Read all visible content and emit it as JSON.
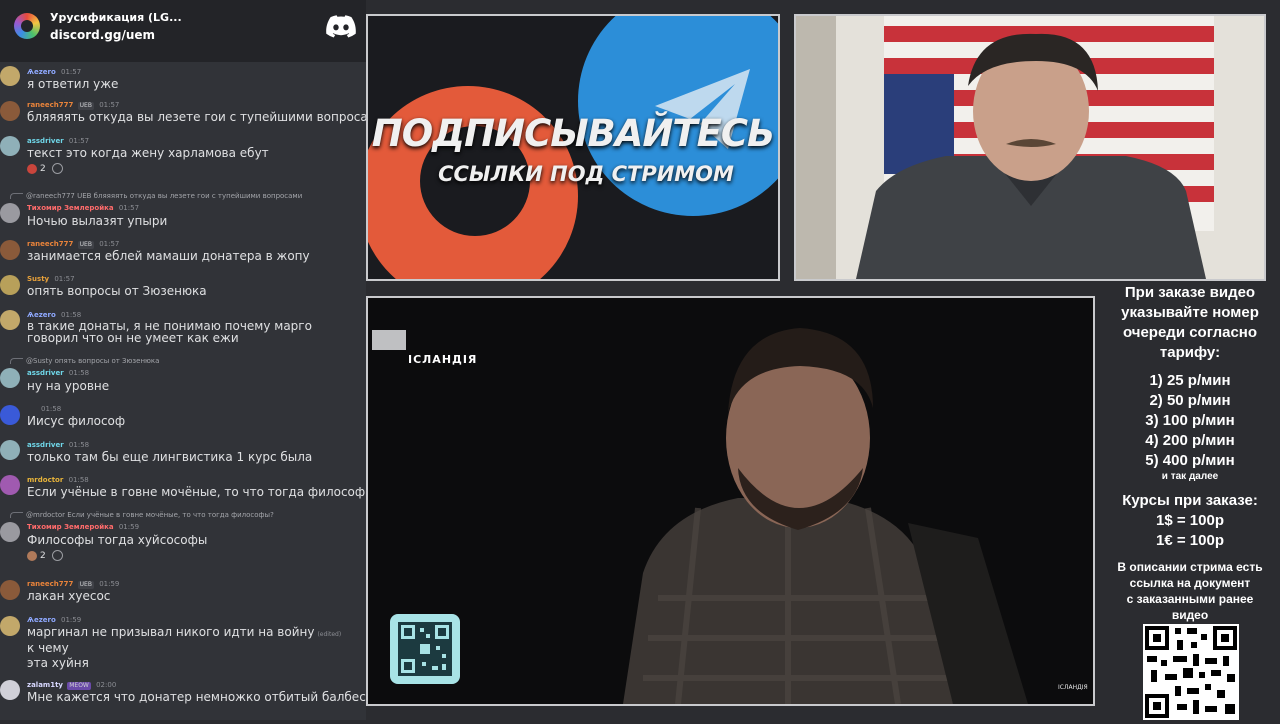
{
  "chat": {
    "server_name": "Урусификация (LG...",
    "invite": "discord.gg/uem",
    "messages": [
      {
        "user": "Ѧezero",
        "user_color": "#8fa9ff",
        "badge": "",
        "time": "01:57",
        "text": "я ответил уже"
      },
      {
        "user": "raneech777",
        "user_color": "#e8833a",
        "badge": "UEB",
        "time": "01:57",
        "text": "бляяяять откуда вы лезете гои с тупейшими вопросами"
      },
      {
        "user": "assdriver",
        "user_color": "#6fd6e8",
        "badge": "",
        "time": "01:57",
        "text": "текст это когда жену харламова ебут",
        "reaction_count": "2"
      },
      {
        "reply": "@raneech777 UEB бляяяять откуда вы лезете гои с тупейшими вопросами",
        "user": "Тихомир Землеройка",
        "user_color": "#ff6b6b",
        "badge": "",
        "time": "01:57",
        "text": "Ночью вылазят упыри"
      },
      {
        "user": "raneech777",
        "user_color": "#e8833a",
        "badge": "UEB",
        "time": "01:57",
        "text": "занимается еблей мамаши донатера в жопу"
      },
      {
        "user": "Susty",
        "user_color": "#e8a13a",
        "badge": "",
        "time": "01:57",
        "text": "опять вопросы от Зюзенюка"
      },
      {
        "user": "Ѧezero",
        "user_color": "#8fa9ff",
        "badge": "",
        "time": "01:58",
        "text": "в такие донаты, я не понимаю почему марго говорил что он не умеет как ежи"
      },
      {
        "reply": "@Susty опять вопросы от Зюзенюка",
        "user": "assdriver",
        "user_color": "#6fd6e8",
        "badge": "",
        "time": "01:58",
        "text": "ну на уровне"
      },
      {
        "user": "",
        "user_color": "#c08cff",
        "badge": "",
        "time": "01:58",
        "text": "Иисус философ"
      },
      {
        "user": "assdriver",
        "user_color": "#6fd6e8",
        "badge": "",
        "time": "01:58",
        "text": "только там бы еще лингвистика 1 курс была"
      },
      {
        "user": "mrdoctor",
        "user_color": "#e8b43a",
        "badge": "",
        "time": "01:58",
        "text": "Если учёные в говне мочёные, то что тогда философы?"
      },
      {
        "reply": "@mrdoctor Если учёные в говне мочёные, то что тогда философы?",
        "user": "Тихомир Землеройка",
        "user_color": "#ff6b6b",
        "badge": "",
        "time": "01:59",
        "text": "Философы тогда хуйсософы",
        "reaction_count": "2"
      },
      {
        "user": "raneech777",
        "user_color": "#e8833a",
        "badge": "UEB",
        "time": "01:59",
        "text": "лакан хуесос"
      },
      {
        "user": "Ѧezero",
        "user_color": "#8fa9ff",
        "badge": "",
        "time": "01:59",
        "text": "маргинал не призывал никого идти на войну",
        "edited": "(edited)",
        "text2": "к чему",
        "text3": "эта хуйня"
      },
      {
        "user": "zalam1ty",
        "user_color": "#d8d8ff",
        "badge": "MEOW",
        "time": "02:00",
        "text": "Мне кажется что донатер немножко отбитый балбес"
      }
    ]
  },
  "promo": {
    "title": "ПОДПИСЫВАЙТЕСЬ",
    "subtitle": "ССЫЛКИ ПОД СТРИМОМ"
  },
  "video": {
    "channel": "ІСЛАНДІЯ",
    "logo": "ІСЛАНДІЯ"
  },
  "prices": {
    "header": [
      "При заказе видео",
      "указывайте номер",
      "очереди согласно",
      "тарифу:"
    ],
    "tiers": [
      "1) 25 р/мин",
      "2) 50 р/мин",
      "3) 100 р/мин",
      "4) 200 р/мин",
      "5) 400 р/мин"
    ],
    "tiers_more": "и так далее",
    "rates_title": "Курсы при заказе:",
    "rates": [
      "1$ = 100р",
      "1€ = 100р"
    ],
    "footer": [
      "В описании стрима есть",
      "ссылка на документ",
      "с заказанными ранее",
      "видео"
    ]
  },
  "colors": {
    "discord": "#5865f2",
    "patreon": "#e35a3a",
    "telegram": "#2c8ed8"
  }
}
